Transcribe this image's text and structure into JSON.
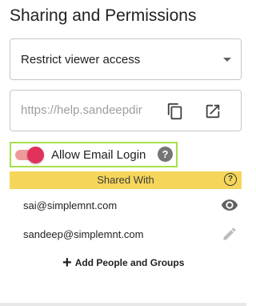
{
  "title": "Sharing and Permissions",
  "access_select": {
    "value": "Restrict viewer access"
  },
  "url_field": {
    "value": "https://help.sandeepdir"
  },
  "email_login": {
    "label": "Allow Email Login",
    "enabled": true,
    "help_glyph": "?"
  },
  "shared_with": {
    "header": "Shared With",
    "help_glyph": "?",
    "users": [
      {
        "email": "sai@simplemnt.com",
        "permission_icon": "eye-icon"
      },
      {
        "email": "sandeep@simplemnt.com",
        "permission_icon": "pencil-icon"
      }
    ]
  },
  "add_button": {
    "glyph": "+",
    "label": "Add People and Groups"
  },
  "colors": {
    "header_bg": "#f5d65b",
    "toggle_thumb": "#e0325a",
    "toggle_track": "#ef9a9a",
    "highlight_border": "#a8e04c"
  }
}
